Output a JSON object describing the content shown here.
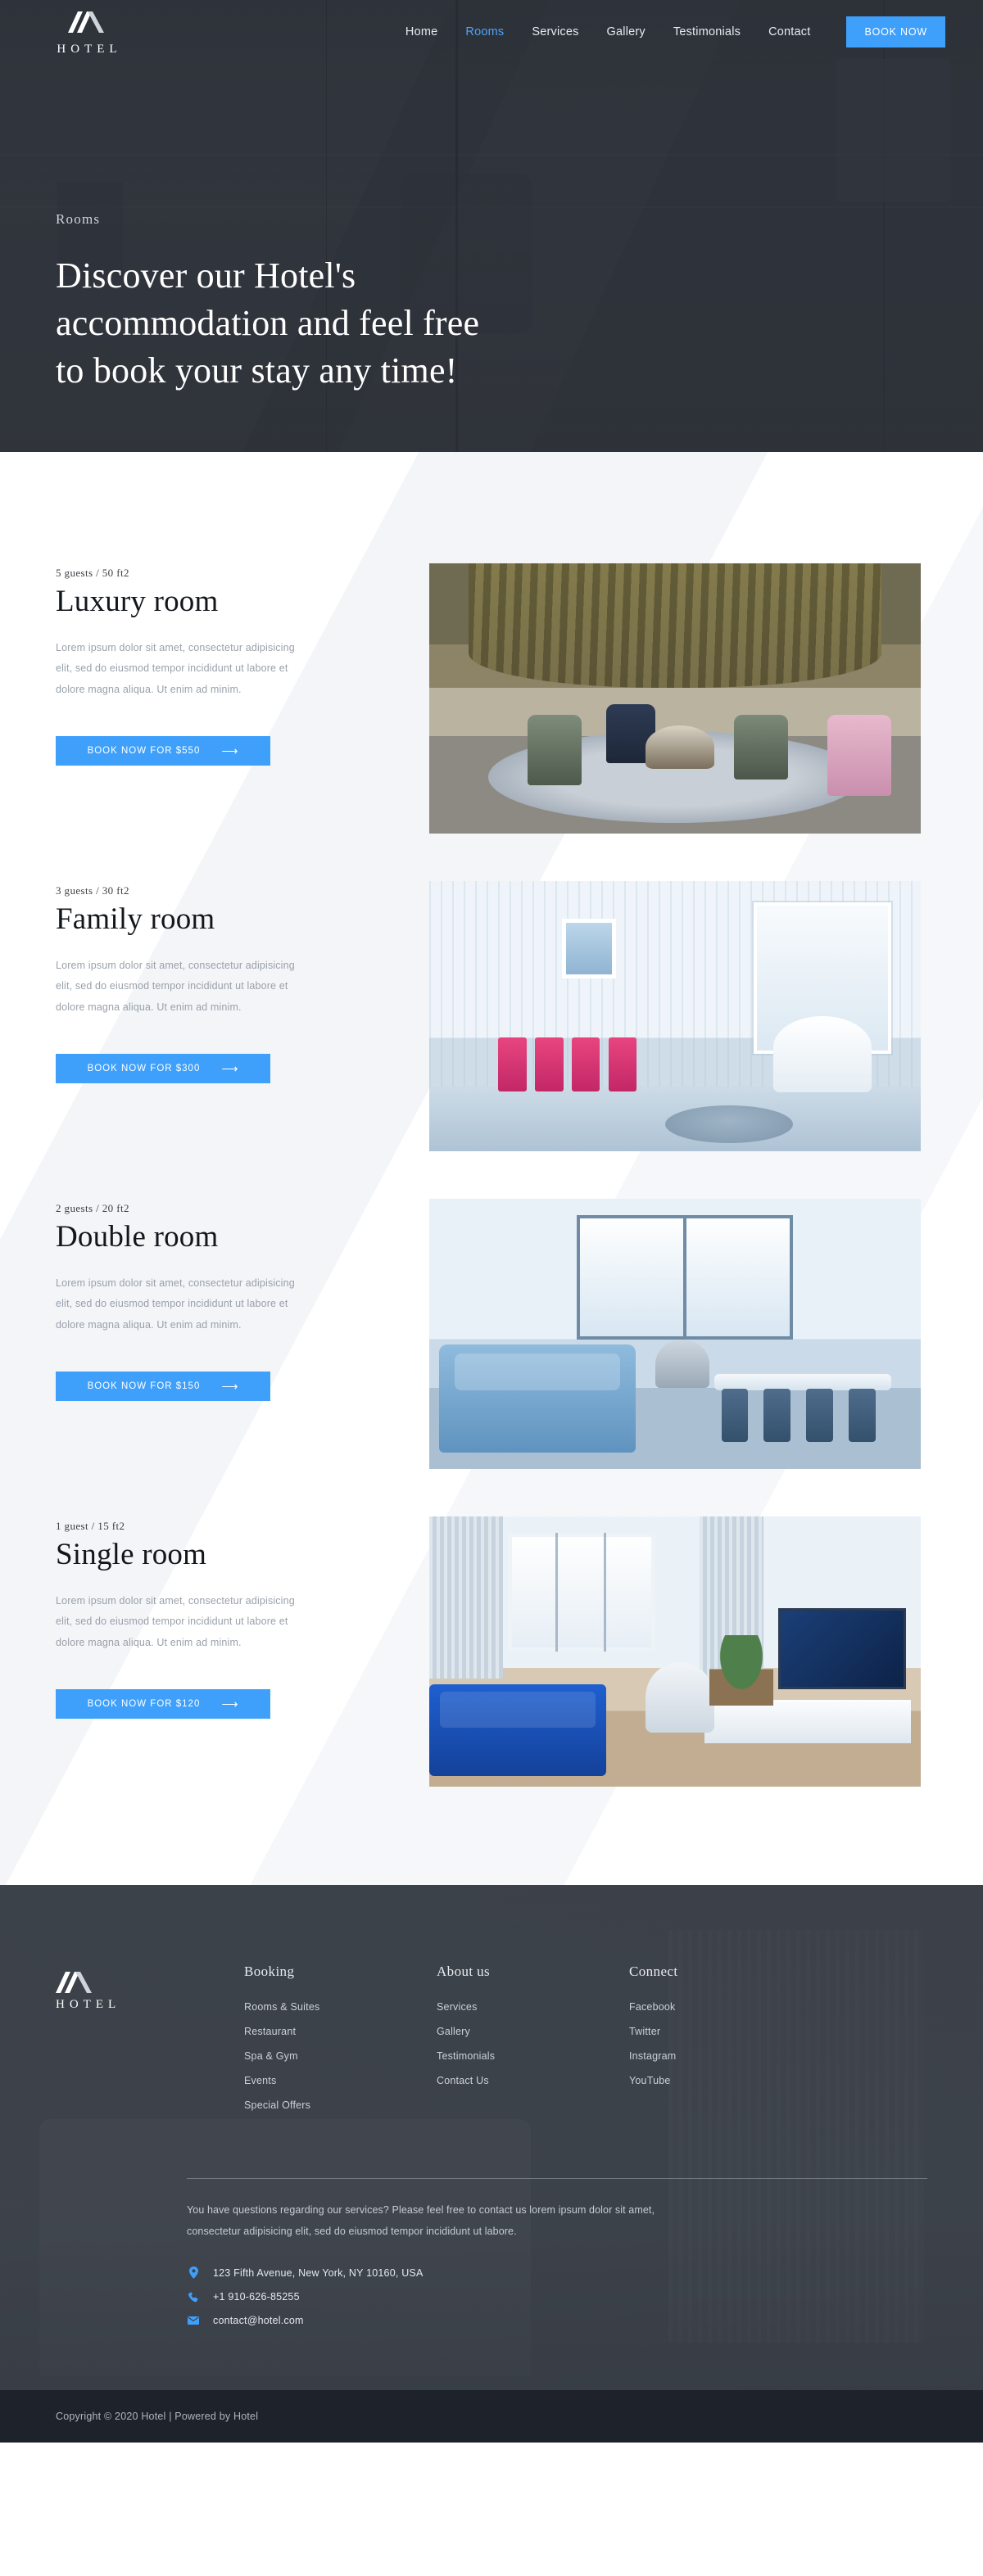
{
  "brand": {
    "name": "HOTEL",
    "logo_icon": "mountain-logo-icon"
  },
  "nav": {
    "items": [
      {
        "label": "Home",
        "active": false
      },
      {
        "label": "Rooms",
        "active": true
      },
      {
        "label": "Services",
        "active": false
      },
      {
        "label": "Gallery",
        "active": false
      },
      {
        "label": "Testimonials",
        "active": false
      },
      {
        "label": "Contact",
        "active": false
      }
    ],
    "cta_label": "BOOK NOW",
    "accent_color": "#3fa0fb",
    "active_color": "#4da4f7"
  },
  "hero": {
    "kicker": "Rooms",
    "title_line1": "Discover our Hotel's",
    "title_line2": "accommodation and feel free",
    "title_line3": "to book your stay any time!"
  },
  "rooms": [
    {
      "meta": "5 guests / 50 ft2",
      "title": "Luxury room",
      "description": "Lorem ipsum dolor sit amet, consectetur adipisicing elit, sed do eiusmod tempor incididunt ut labore et dolore magna aliqua. Ut enim ad minim.",
      "button_label": "BOOK NOW FOR $550",
      "price": "$550",
      "arrow_icon": "arrow-right-icon",
      "photo": "luxury-room-photo"
    },
    {
      "meta": "3 guests / 30 ft2",
      "title": "Family room",
      "description": "Lorem ipsum dolor sit amet, consectetur adipisicing elit, sed do eiusmod tempor incididunt ut labore et dolore magna aliqua. Ut enim ad minim.",
      "button_label": "BOOK NOW FOR $300",
      "price": "$300",
      "arrow_icon": "arrow-right-icon",
      "photo": "family-room-photo"
    },
    {
      "meta": "2 guests / 20 ft2",
      "title": "Double room",
      "description": "Lorem ipsum dolor sit amet, consectetur adipisicing elit, sed do eiusmod tempor incididunt ut labore et dolore magna aliqua. Ut enim ad minim.",
      "button_label": "BOOK NOW FOR $150",
      "price": "$150",
      "arrow_icon": "arrow-right-icon",
      "photo": "double-room-photo"
    },
    {
      "meta": "1 guest / 15 ft2",
      "title": "Single room",
      "description": "Lorem ipsum dolor sit amet, consectetur adipisicing elit, sed do eiusmod tempor incididunt ut labore et dolore magna aliqua. Ut enim ad minim.",
      "button_label": "BOOK NOW FOR $120",
      "price": "$120",
      "arrow_icon": "arrow-right-icon",
      "photo": "single-room-photo"
    }
  ],
  "footer": {
    "columns": [
      {
        "heading": "Booking",
        "links": [
          "Rooms & Suites",
          "Restaurant",
          "Spa & Gym",
          "Events",
          "Special Offers"
        ]
      },
      {
        "heading": "About us",
        "links": [
          "Services",
          "Gallery",
          "Testimonials",
          "Contact Us"
        ]
      },
      {
        "heading": "Connect",
        "links": [
          "Facebook",
          "Twitter",
          "Instagram",
          "YouTube"
        ]
      }
    ],
    "note": "You have questions regarding our services? Please feel free to contact us lorem ipsum dolor sit amet, consectetur adipisicing elit, sed do eiusmod tempor incididunt ut labore.",
    "contacts": [
      {
        "icon": "location-pin-icon",
        "text": "123 Fifth Avenue, New York, NY 10160, USA"
      },
      {
        "icon": "phone-icon",
        "text": "+1 910-626-85255"
      },
      {
        "icon": "envelope-icon",
        "text": "contact@hotel.com"
      }
    ],
    "copyright": "Copyright © 2020 Hotel | Powered by Hotel"
  }
}
